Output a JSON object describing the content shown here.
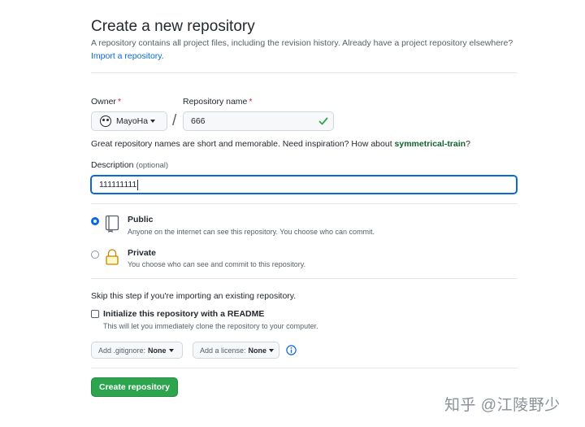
{
  "header": {
    "title": "Create a new repository",
    "subtitle": "A repository contains all project files, including the revision history. Already have a project repository elsewhere?",
    "import_link": "Import a repository."
  },
  "owner": {
    "label": "Owner",
    "required_mark": "*",
    "value": "MayoHa"
  },
  "repo": {
    "label": "Repository name",
    "required_mark": "*",
    "value": "666",
    "valid_icon": "check-icon",
    "slash": "/"
  },
  "hint": {
    "text": "Great repository names are short and memorable. Need inspiration? How about ",
    "suggestion": "symmetrical-train",
    "end": "?"
  },
  "description": {
    "label": "Description",
    "optional": "(optional)",
    "value": "111111111"
  },
  "visibility": {
    "selected": "public",
    "public": {
      "title": "Public",
      "desc": "Anyone on the internet can see this repository. You choose who can commit.",
      "icon": "repo-icon"
    },
    "private": {
      "title": "Private",
      "desc": "You choose who can see and commit to this repository.",
      "icon": "lock-icon"
    }
  },
  "init": {
    "skip_text": "Skip this step if you're importing an existing repository.",
    "readme_title": "Initialize this repository with a README",
    "readme_desc": "This will let you immediately clone the repository to your computer.",
    "readme_checked": false,
    "gitignore_label": "Add .gitignore:",
    "gitignore_value": "None",
    "license_label": "Add a license:",
    "license_value": "None",
    "info_icon": "info-icon"
  },
  "actions": {
    "create_label": "Create repository"
  },
  "watermark": "知乎 @江陵野少",
  "colors": {
    "accent": "#0969da",
    "success": "#2da44e",
    "required": "#cf222e",
    "suggestion": "#116329"
  }
}
